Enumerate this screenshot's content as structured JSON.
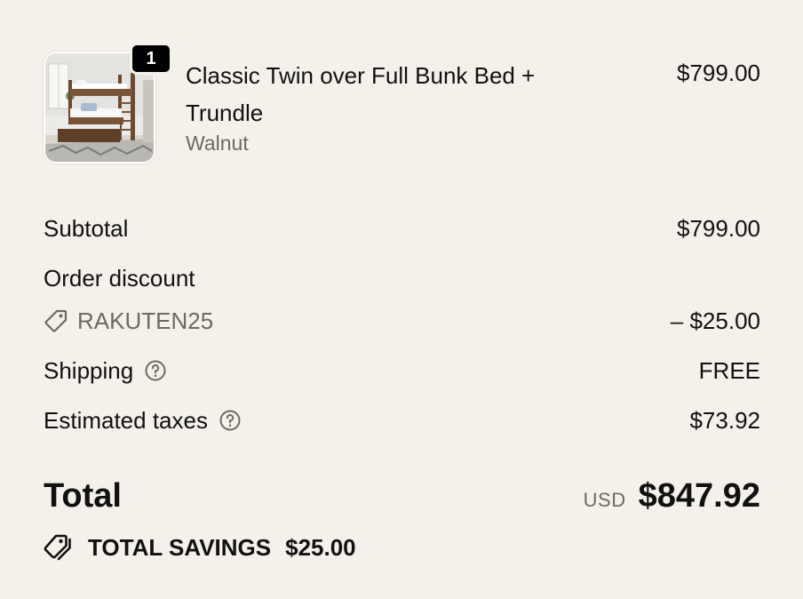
{
  "line_item": {
    "quantity": "1",
    "name": "Classic Twin over Full Bunk Bed + Trundle",
    "variant": "Walnut",
    "price": "$799.00",
    "image_icon": "bunk-bed-product-image"
  },
  "costs": {
    "subtotal_label": "Subtotal",
    "subtotal_value": "$799.00",
    "discount_title": "Order discount",
    "discount_code": "RAKUTEN25",
    "discount_value": "– $25.00",
    "shipping_label": "Shipping",
    "shipping_value": "FREE",
    "taxes_label": "Estimated taxes",
    "taxes_value": "$73.92"
  },
  "total": {
    "label": "Total",
    "currency": "USD",
    "amount": "$847.92"
  },
  "savings": {
    "label": "TOTAL SAVINGS",
    "amount": "$25.00"
  },
  "icons": {
    "tag": "tag-icon",
    "help": "question-circle-icon",
    "savings": "double-tag-icon"
  },
  "colors": {
    "background": "#f4f1ea",
    "text": "#111111",
    "muted": "#6e6a63",
    "badge": "#000000"
  }
}
